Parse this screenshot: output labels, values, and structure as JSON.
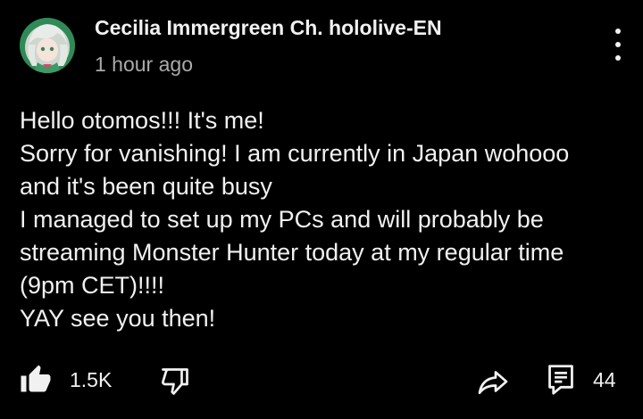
{
  "post": {
    "author": "Cecilia Immergreen Ch. hololive-EN",
    "time": "1 hour ago",
    "lines": [
      "Hello otomos!!! It's me!",
      "Sorry for vanishing! I am currently in Japan wohooo",
      "and it's been quite busy",
      "I managed to set up my PCs and will probably be",
      "streaming Monster Hunter today at my regular time",
      "(9pm CET)!!!!",
      "YAY see you then!"
    ]
  },
  "actions": {
    "like_count": "1.5K",
    "comment_count": "44"
  },
  "icons": {
    "avatar": "avatar-icon",
    "menu": "more-vert-icon",
    "like": "thumbs-up-icon",
    "dislike": "thumbs-down-icon",
    "share": "share-arrow-icon",
    "comment": "comment-icon"
  },
  "colors": {
    "background": "#000000",
    "text": "#f1f1f1",
    "secondary_text": "#aaaaaa",
    "avatar_ring": "#2f8a57"
  }
}
